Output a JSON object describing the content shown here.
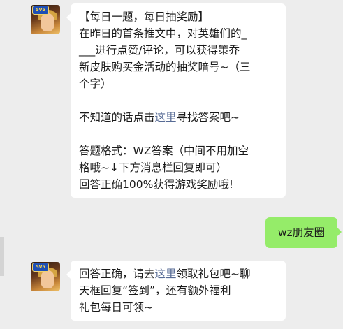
{
  "messages": {
    "first": {
      "title": "【每日一题，每日抽奖励】",
      "question_lines": [
        "在昨日的首条推文中，对英雄们的_",
        "___进行点赞/评论，可以获得策乔",
        "新皮肤购买金活动的抽奖暗号~（三",
        "个字）"
      ],
      "hint_prefix": "不知道的话点击",
      "hint_link": "这里",
      "hint_suffix": "寻找答案吧~",
      "format_lines": [
        "答题格式：WZ答案（中间不用加空",
        "格哦~↓下方消息栏回复即可）",
        "回答正确100%获得游戏奖励哦!"
      ]
    },
    "reply": {
      "text": "wz朋友圈"
    },
    "second": {
      "prefix": "回答正确，请去",
      "link": "这里",
      "line1_suffix": "领取礼包吧~聊",
      "line2": "天框回复“签到”，还有额外福利",
      "line3": "礼包每日可领~"
    }
  },
  "avatar": {
    "logo_text": "5v5",
    "icon": "game-hero-avatar"
  },
  "colors": {
    "background": "#ededed",
    "incoming_bubble": "#ffffff",
    "outgoing_bubble": "#95ec69",
    "link": "#576b95"
  }
}
